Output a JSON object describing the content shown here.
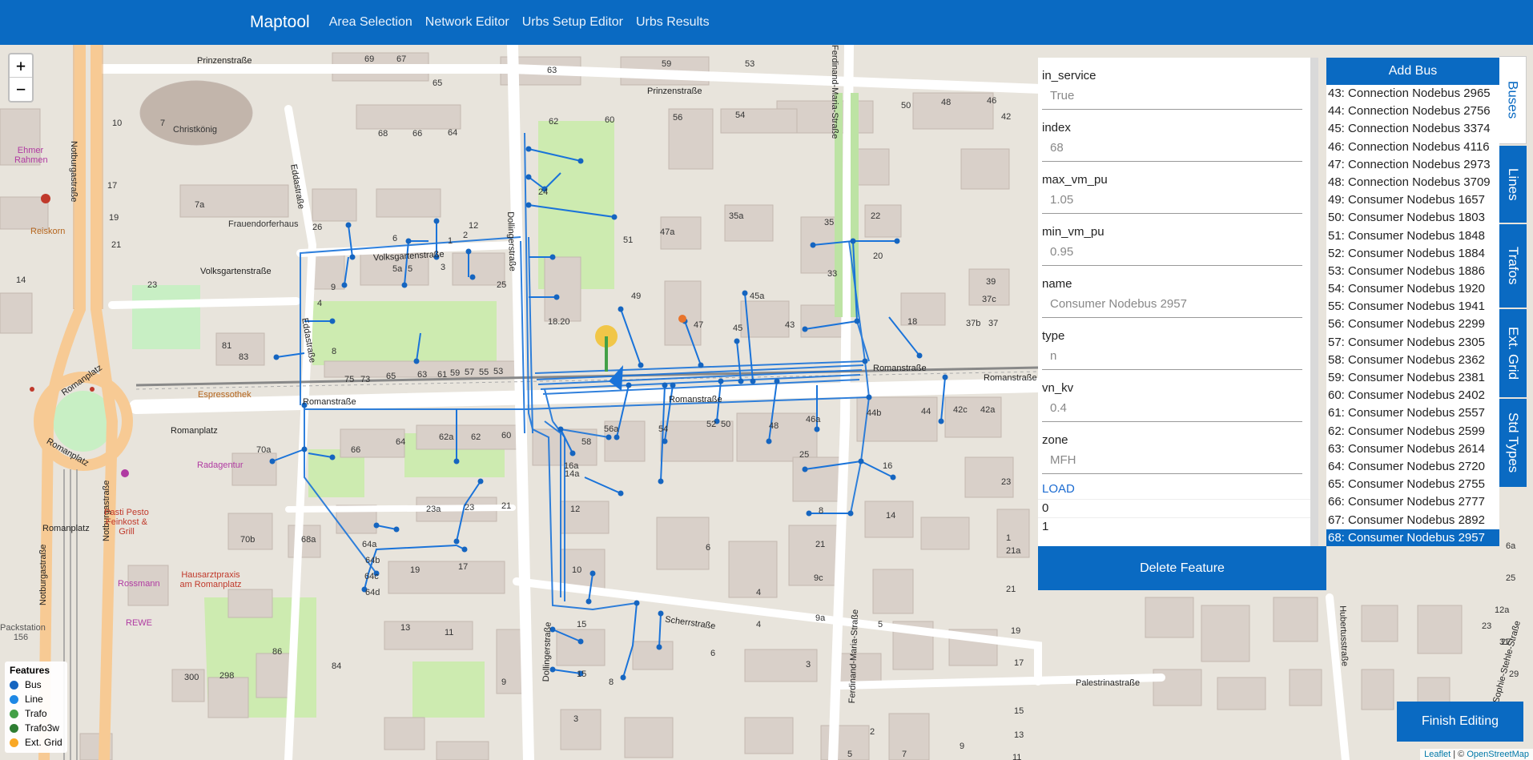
{
  "navbar": {
    "brand": "Maptool",
    "links": [
      "Area Selection",
      "Network Editor",
      "Urbs Setup Editor",
      "Urbs Results"
    ]
  },
  "map": {
    "streets": [
      "Prinzenstraße",
      "Prinzenstraße",
      "Notburgastraße",
      "Notburgastraße",
      "Eddastraße",
      "Volksgartenstraße",
      "Volksgartenstraße",
      "Romanplatz",
      "Romanplatz",
      "Romanstraße",
      "Romanstraße",
      "Romanstraße",
      "Romanstraße",
      "Dollingerstraße",
      "Dollingerstraße",
      "Ferdinand-Maria-Straße",
      "Ferdinand-Maria-Straße",
      "Scherrstraße",
      "Palestrinastraße",
      "Hubertusstraße",
      "Sophie-Stehle-Straße",
      "Eddastraße",
      "Romanplatz",
      "Romanplatz",
      "Notburgastraße"
    ],
    "places": [
      "Christkönig",
      "Frauendorferhaus",
      "Ehmer Rahmen",
      "Reiskorn",
      "Espressothek",
      "Radagentur",
      "Pasti Pesto Feinkost & Grill",
      "Rossmann",
      "REWE",
      "Hausarztpraxis am Romanplatz",
      "Packstation 156"
    ],
    "house_numbers": [
      "69",
      "67",
      "65",
      "63",
      "59",
      "53",
      "62",
      "60",
      "56",
      "54",
      "50",
      "48",
      "46",
      "42",
      "68",
      "66",
      "64",
      "24",
      "51",
      "47a",
      "35a",
      "35",
      "22",
      "20",
      "33",
      "49",
      "47",
      "45a",
      "45",
      "43",
      "18",
      "39",
      "37c",
      "37b",
      "37",
      "10",
      "7",
      "7a",
      "17",
      "19",
      "21",
      "14",
      "23",
      "2",
      "1",
      "4",
      "81",
      "83",
      "73",
      "75",
      "65",
      "63",
      "61",
      "59",
      "57",
      "55",
      "53",
      "3",
      "25",
      "18.20",
      "9",
      "5a",
      "5",
      "6",
      "26",
      "12",
      "8",
      "70a",
      "70b",
      "68a",
      "66",
      "64",
      "62a",
      "62",
      "60",
      "58",
      "56a",
      "54",
      "52",
      "50",
      "48",
      "46a",
      "44b",
      "44",
      "42c",
      "42a",
      "25",
      "23",
      "16",
      "14",
      "23a",
      "23",
      "21",
      "64a",
      "64b",
      "64c",
      "64d",
      "19",
      "17",
      "15",
      "10",
      "12",
      "4",
      "6",
      "9",
      "11",
      "13",
      "15",
      "8",
      "86",
      "84",
      "300",
      "298",
      "14a",
      "16a",
      "21",
      "4",
      "6",
      "8",
      "9c",
      "9a",
      "5",
      "3",
      "1",
      "21a",
      "21",
      "19",
      "17",
      "15",
      "13",
      "11",
      "9",
      "7",
      "5",
      "3",
      "2",
      "6a",
      "25",
      "23",
      "27",
      "29",
      "31",
      "12a",
      "12"
    ],
    "zoom_in": "+",
    "zoom_out": "−",
    "legend": {
      "title": "Features",
      "items": [
        {
          "label": "Bus",
          "color": "#1565c0"
        },
        {
          "label": "Line",
          "color": "#1e88e5"
        },
        {
          "label": "Trafo",
          "color": "#43a047"
        },
        {
          "label": "Trafo3w",
          "color": "#2e7d32"
        },
        {
          "label": "Ext. Grid",
          "color": "#f9a825"
        }
      ]
    },
    "attribution": {
      "leaflet": "Leaflet",
      "sep": " | © ",
      "osm": "OpenStreetMap"
    }
  },
  "properties": {
    "fields": [
      {
        "label": "in_service",
        "value": "True"
      },
      {
        "label": "index",
        "value": "68"
      },
      {
        "label": "max_vm_pu",
        "value": "1.05"
      },
      {
        "label": "min_vm_pu",
        "value": "0.95"
      },
      {
        "label": "name",
        "value": "Consumer Nodebus 2957"
      },
      {
        "label": "type",
        "value": "n"
      },
      {
        "label": "vn_kv",
        "value": "0.4"
      },
      {
        "label": "zone",
        "value": "MFH"
      }
    ],
    "load_link": "LOAD",
    "load_items": [
      "0",
      "1"
    ],
    "delete_label": "Delete Feature"
  },
  "buslist": {
    "add_label": "Add Bus",
    "items": [
      "43: Connection Nodebus 2965",
      "44: Connection Nodebus 2756",
      "45: Connection Nodebus 3374",
      "46: Connection Nodebus 4116",
      "47: Connection Nodebus 2973",
      "48: Connection Nodebus 3709",
      "49: Consumer Nodebus 1657",
      "50: Consumer Nodebus 1803",
      "51: Consumer Nodebus 1848",
      "52: Consumer Nodebus 1884",
      "53: Consumer Nodebus 1886",
      "54: Consumer Nodebus 1920",
      "55: Consumer Nodebus 1941",
      "56: Consumer Nodebus 2299",
      "57: Consumer Nodebus 2305",
      "58: Consumer Nodebus 2362",
      "59: Consumer Nodebus 2381",
      "60: Consumer Nodebus 2402",
      "61: Consumer Nodebus 2557",
      "62: Consumer Nodebus 2599",
      "63: Consumer Nodebus 2614",
      "64: Consumer Nodebus 2720",
      "65: Consumer Nodebus 2755",
      "66: Consumer Nodebus 2777",
      "67: Consumer Nodebus 2892",
      "68: Consumer Nodebus 2957"
    ],
    "selected": "68: Consumer Nodebus 2957"
  },
  "tabs": [
    "Buses",
    "Lines",
    "Trafos",
    "Ext. Grid",
    "Std Types"
  ],
  "active_tab": "Buses",
  "finish_label": "Finish Editing"
}
